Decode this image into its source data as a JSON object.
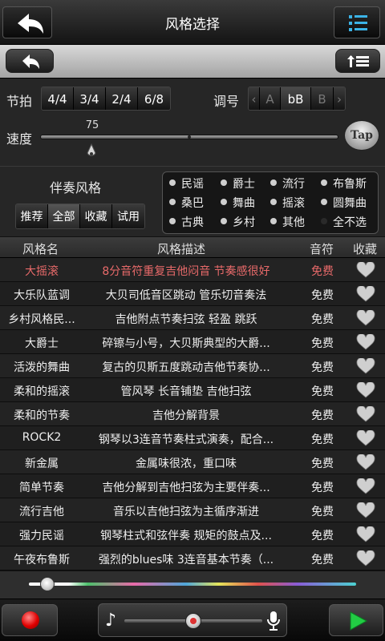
{
  "header": {
    "title": "风格选择"
  },
  "meter": {
    "label": "节拍",
    "options": [
      "4/4",
      "3/4",
      "2/4",
      "6/8"
    ]
  },
  "key": {
    "label": "调号",
    "prev_glyph": "‹",
    "next_glyph": "›",
    "options": [
      "A",
      "bB",
      "B"
    ],
    "selected": "bB"
  },
  "tempo": {
    "label": "速度",
    "value": "75",
    "tap_label": "Tap"
  },
  "accompaniment": {
    "label": "伴奏风格",
    "filters": [
      "推荐",
      "全部",
      "收藏",
      "试用"
    ],
    "selected_filter": "全部"
  },
  "genres": [
    {
      "label": "民谣",
      "on": true
    },
    {
      "label": "爵士",
      "on": true
    },
    {
      "label": "流行",
      "on": true
    },
    {
      "label": "布鲁斯",
      "on": true
    },
    {
      "label": "桑巴",
      "on": true
    },
    {
      "label": "舞曲",
      "on": true
    },
    {
      "label": "摇滚",
      "on": true
    },
    {
      "label": "圆舞曲",
      "on": true
    },
    {
      "label": "古典",
      "on": true
    },
    {
      "label": "乡村",
      "on": true
    },
    {
      "label": "其他",
      "on": true
    },
    {
      "label": "全不选",
      "on": false
    }
  ],
  "table": {
    "columns": [
      "风格名",
      "风格描述",
      "音符",
      "收藏"
    ],
    "rows": [
      {
        "name": "大摇滚",
        "desc": "8分音符重复吉他闷音 节奏感很好",
        "price": "免费",
        "highlight": true
      },
      {
        "name": "大乐队蓝调",
        "desc": "大贝司低音区跳动 管乐切音奏法",
        "price": "免费"
      },
      {
        "name": "乡村风格民...",
        "desc": "吉他附点节奏扫弦 轻盈 跳跃",
        "price": "免费"
      },
      {
        "name": "大爵士",
        "desc": "碎镲与小号，大贝斯典型的大爵...",
        "price": "免费"
      },
      {
        "name": "活泼的舞曲",
        "desc": "复古的贝斯五度跳动吉他节奏协...",
        "price": "免费"
      },
      {
        "name": "柔和的摇滚",
        "desc": "管风琴 长音铺垫 吉他扫弦",
        "price": "免费"
      },
      {
        "name": "柔和的节奏",
        "desc": "吉他分解背景",
        "price": "免费"
      },
      {
        "name": "ROCK2",
        "desc": "钢琴以3连音节奏柱式演奏，配合...",
        "price": "免费"
      },
      {
        "name": "新金属",
        "desc": "金属味很浓，重口味",
        "price": "免费"
      },
      {
        "name": "简单节奏",
        "desc": "吉他分解到吉他扫弦为主要伴奏...",
        "price": "免费"
      },
      {
        "name": "流行吉他",
        "desc": "音乐以吉他扫弦为主循序渐进",
        "price": "免费"
      },
      {
        "name": "强力民谣",
        "desc": "钢琴柱式和弦伴奏 规矩的鼓点及...",
        "price": "免费"
      },
      {
        "name": "午夜布鲁斯",
        "desc": "强烈的blues味 3连音基本节奏（...",
        "price": "免费"
      }
    ]
  },
  "player": {
    "note_glyph": "♪"
  },
  "colors": {
    "highlight_text": "#e86a6a",
    "record": "#e00000",
    "play": "#22cc44"
  }
}
